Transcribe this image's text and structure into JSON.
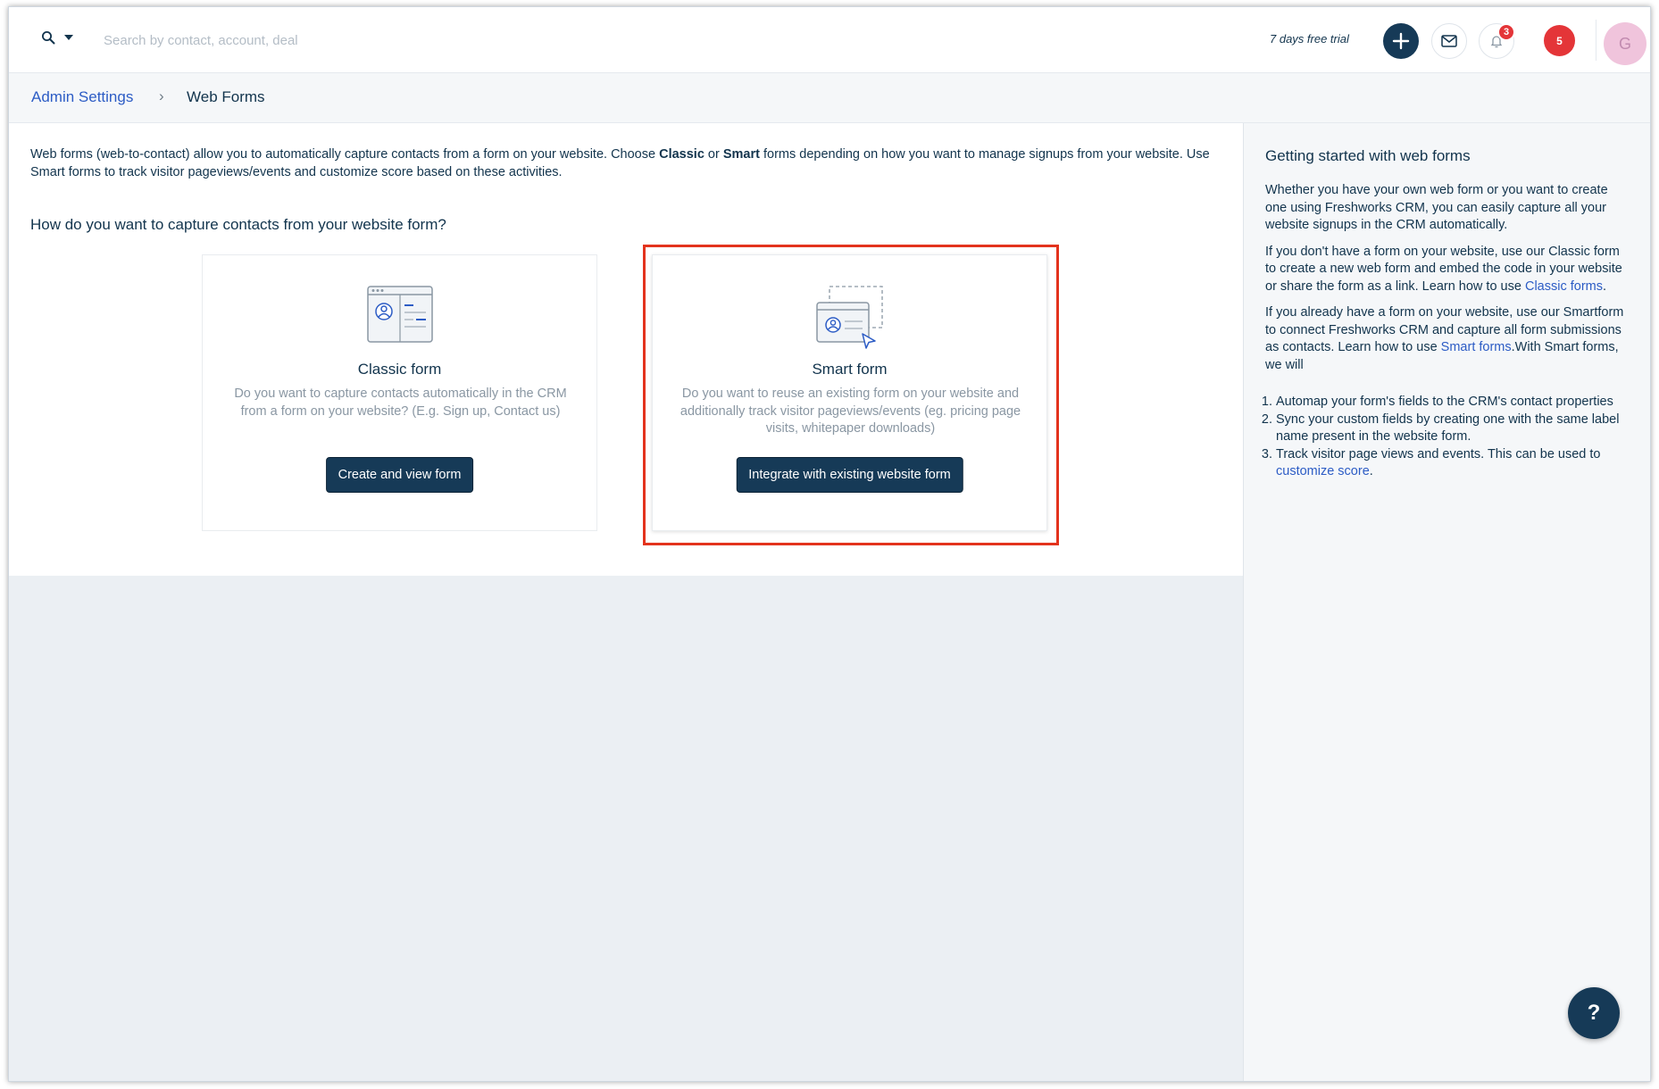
{
  "header": {
    "search_placeholder": "Search by contact, account, deal",
    "trial_text": "7 days free trial",
    "bell_badge_count": "3",
    "notifications_count": "5",
    "avatar_initial": "G",
    "accent_color": "#163a57",
    "badge_color": "#e43538"
  },
  "breadcrumb": {
    "parent": "Admin Settings",
    "separator": "›",
    "current": "Web Forms"
  },
  "main": {
    "intro_part1": "Web forms (web-to-contact) allow you to automatically capture contacts from a form on your website. Choose ",
    "intro_classic": "Classic",
    "intro_or": " or ",
    "intro_smart": "Smart",
    "intro_part2": " forms depending on how you want to manage signups from your website. Use Smart forms to track visitor pageviews/events and customize score based on these activities.",
    "question": "How do you want to capture contacts from your website form?",
    "cards": [
      {
        "title": "Classic form",
        "description": "Do you want to capture contacts automatically in the CRM from a form on your website? (E.g. Sign up, Contact us)",
        "button": "Create and view form"
      },
      {
        "title": "Smart form",
        "description": "Do you want to reuse an existing form on your website and additionally track visitor pageviews/events (eg. pricing page visits, whitepaper downloads)",
        "button": "Integrate with existing website form"
      }
    ]
  },
  "sidebar": {
    "title": "Getting started with web forms",
    "p1": "Whether you have your own web form or you want to create one using Freshworks CRM, you can easily capture all your website signups in the CRM automatically.",
    "p2_text": "If you don't have a form on your website, use our Classic form to create a new web form and embed the code in your website or share the form as a link. Learn how to use ",
    "p2_link": "Classic forms",
    "p2_end": ".",
    "p3_text": "If you already have a form on your website, use our Smartform to connect Freshworks CRM and capture all form submissions as contacts. Learn how to use ",
    "p3_link": "Smart forms",
    "p3_end": ".With Smart forms, we will",
    "list": [
      "Automap your form's fields to the CRM's contact properties",
      "Sync your custom fields by creating one with the same label name present in the website form.",
      "Track visitor page views and events. This can be used to "
    ],
    "list3_link": "customize score",
    "list3_end": "."
  },
  "help_button": "?"
}
